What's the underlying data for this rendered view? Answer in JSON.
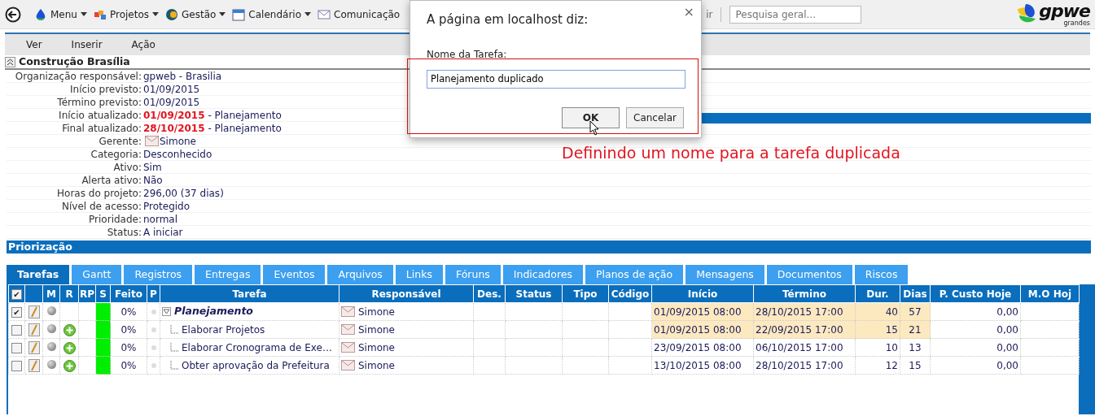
{
  "toolbar": {
    "menus": [
      {
        "label": "Menu"
      },
      {
        "label": "Projetos"
      },
      {
        "label": "Gestão"
      },
      {
        "label": "Calendário"
      },
      {
        "label": "Comunicação"
      }
    ],
    "hidden_item_tail": "ir",
    "search": {
      "placeholder": "Pesquisa geral..."
    },
    "logo": {
      "text": "gpwe",
      "tagline": "grandes"
    }
  },
  "menu_bar": [
    "Ver",
    "Inserir",
    "Ação"
  ],
  "project": {
    "title": "Construção Brasília",
    "fields": [
      {
        "label": "Organização responsável:",
        "value": "gpweb - Brasilia",
        "kind": "plain"
      },
      {
        "label": "Início previsto:",
        "value": "01/09/2015",
        "kind": "plain"
      },
      {
        "label": "Término previsto:",
        "value": "01/09/2015",
        "kind": "plain"
      },
      {
        "label": "Início atualizado:",
        "date": "01/09/2015",
        "value": " - Planejamento",
        "kind": "late_date"
      },
      {
        "label": "Final atualizado:",
        "date": "28/10/2015",
        "value": " - Planejamento",
        "kind": "late_date"
      },
      {
        "label": "Gerente:",
        "value": "Simone",
        "kind": "person"
      },
      {
        "label": "Categoria:",
        "value": "Desconhecido",
        "kind": "plain"
      },
      {
        "label": "Ativo:",
        "value": "Sim",
        "kind": "plain"
      },
      {
        "label": "Alerta ativo:",
        "value": "Não",
        "kind": "plain"
      },
      {
        "label": "Horas do projeto:",
        "value": "296,00 (37 dias)",
        "kind": "plain"
      },
      {
        "label": "Nível de acesso:",
        "value": "Protegido",
        "kind": "plain"
      },
      {
        "label": "Prioridade:",
        "value": "normal",
        "kind": "plain"
      },
      {
        "label": "Status:",
        "value": "A iniciar",
        "kind": "plain"
      }
    ],
    "section": "Priorização"
  },
  "annotation": "Definindo um nome para a tarefa duplicada",
  "tabs": [
    {
      "label": "Tarefas",
      "selected": true
    },
    {
      "label": "Gantt",
      "selected": false
    },
    {
      "label": "Registros",
      "selected": false
    },
    {
      "label": "Entregas",
      "selected": false
    },
    {
      "label": "Eventos",
      "selected": false
    },
    {
      "label": "Arquivos",
      "selected": false
    },
    {
      "label": "Links",
      "selected": false
    },
    {
      "label": "Fóruns",
      "selected": false
    },
    {
      "label": "Indicadores",
      "selected": false
    },
    {
      "label": "Planos de ação",
      "selected": false
    },
    {
      "label": "Mensagens",
      "selected": false
    },
    {
      "label": "Documentos",
      "selected": false
    },
    {
      "label": "Riscos",
      "selected": false
    }
  ],
  "table": {
    "columns": [
      "",
      "M",
      "R",
      "RP",
      "S",
      "Feito",
      "P",
      "Tarefa",
      "Responsável",
      "Des.",
      "Status",
      "Tipo",
      "Código",
      "Início",
      "Término",
      "Dur.",
      "Dias",
      "P. Custo Hoje",
      "M.O Hoj"
    ],
    "header_checked": true,
    "check_mark": "✔",
    "rows": [
      {
        "checked": true,
        "addable": false,
        "color": "#00ee00",
        "done": "0%",
        "task": "Planejamento",
        "expanded": true,
        "responsible": "Simone",
        "start": "01/09/2015 08:00",
        "end": "28/10/2015 17:00",
        "duration": "40",
        "days": "57",
        "cost": "0,00",
        "highlighted": true,
        "children": [
          {
            "checked": false,
            "addable": true,
            "color": "#00ee00",
            "done": "0%",
            "task": "Elaborar Projetos",
            "responsible": "Simone",
            "start": "01/09/2015 08:00",
            "end": "22/09/2015 17:00",
            "duration": "15",
            "days": "21",
            "cost": "0,00",
            "highlighted": true
          },
          {
            "checked": false,
            "addable": true,
            "color": "#00ee00",
            "done": "0%",
            "task": "Elaborar Cronograma de Exe…",
            "responsible": "Simone",
            "start": "23/09/2015 08:00",
            "end": "06/10/2015 17:00",
            "duration": "10",
            "days": "13",
            "cost": "0,00",
            "highlighted": false
          },
          {
            "checked": false,
            "addable": true,
            "color": "#00ee00",
            "done": "0%",
            "task": "Obter aprovação da Prefeitura",
            "responsible": "Simone",
            "start": "13/10/2015 08:00",
            "end": "28/10/2015 17:00",
            "duration": "12",
            "days": "15",
            "cost": "0,00",
            "highlighted": false
          }
        ]
      }
    ]
  },
  "dialog": {
    "title": "A página em localhost diz:",
    "close": "×",
    "label": "Nome da Tarefa:",
    "value": "Planejamento duplicado",
    "buttons": [
      {
        "label": "OK",
        "kind": "default"
      },
      {
        "label": "Cancelar",
        "kind": "normal"
      }
    ]
  }
}
